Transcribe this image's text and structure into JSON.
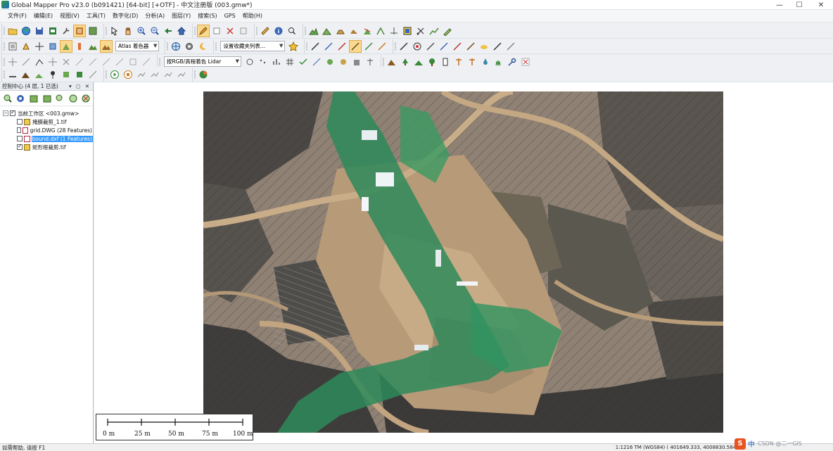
{
  "window": {
    "title": "Global Mapper Pro v23.0 (b091421) [64-bit] [+OTF] - 中文注册版 (003.gmw*)",
    "controls": {
      "minimize": "—",
      "maximize": "☐",
      "close": "✕"
    }
  },
  "menu": [
    "文件(F)",
    "编辑(E)",
    "视图(V)",
    "工具(T)",
    "数字化(D)",
    "分析(A)",
    "图层(Y)",
    "搜索(S)",
    "GPS",
    "帮助(H)"
  ],
  "toolbar": {
    "shader_combo": "Atlas 着色器",
    "favorites_combo": "设置收藏夹列表...",
    "lidar_color_combo": "按RGB/高程着色 Lidar"
  },
  "control_center": {
    "title": "控制中心 (4 层, 1 已选)",
    "header_buttons": "▾ ◻ ✕",
    "workspace": "当前工作区 <003.gmw>",
    "layers": [
      {
        "name": "掩膜裁剪_1.tif",
        "checked": false,
        "selected": false,
        "icon": "raster-layer-icon"
      },
      {
        "name": "grid.DWG (28 Features)",
        "checked": false,
        "selected": false,
        "icon": "vector-layer-icon"
      },
      {
        "name": "bound.dxf (1 Features)",
        "checked": false,
        "selected": true,
        "icon": "vector-layer-icon"
      },
      {
        "name": "矩形框裁剪.tif",
        "checked": true,
        "selected": false,
        "icon": "raster-layer-icon"
      }
    ]
  },
  "scale_bar": {
    "labels": [
      "0 m",
      "25 m",
      "50 m",
      "75 m",
      "100 m"
    ]
  },
  "status": {
    "help_text": "如需帮助, 请按 F1",
    "coords_text": "1:1216  TM (WGS84) ( 401649.333, 4008830.584"
  },
  "ime": {
    "logo": "S",
    "mode": "中",
    "watermark": "CSDN @二一GIS"
  },
  "colors": {
    "selection": "#3399ff",
    "active_tool": "#f9d98f",
    "ime_brand": "#e8531f"
  }
}
